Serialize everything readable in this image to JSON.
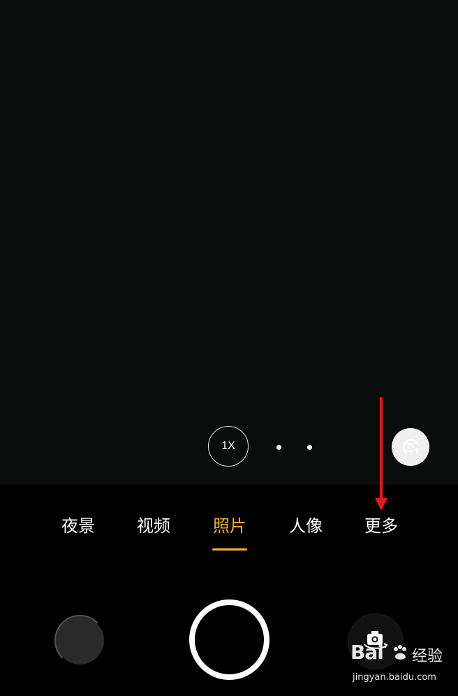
{
  "zoom": {
    "label": "1X"
  },
  "modes": [
    {
      "label": "夜景"
    },
    {
      "label": "视频"
    },
    {
      "label": "照片",
      "active": true
    },
    {
      "label": "人像"
    },
    {
      "label": "更多"
    }
  ],
  "colors": {
    "active_mode": "#f0b23a",
    "annotation_arrow": "#e01b1b",
    "viewfinder": "#0b0c0c"
  },
  "icons": {
    "beauty": "beauty-face-icon",
    "switch_camera": "switch-camera-icon"
  },
  "watermark": {
    "logo": "Bai",
    "site": "经验",
    "url": "jingyan.baidu.com"
  }
}
